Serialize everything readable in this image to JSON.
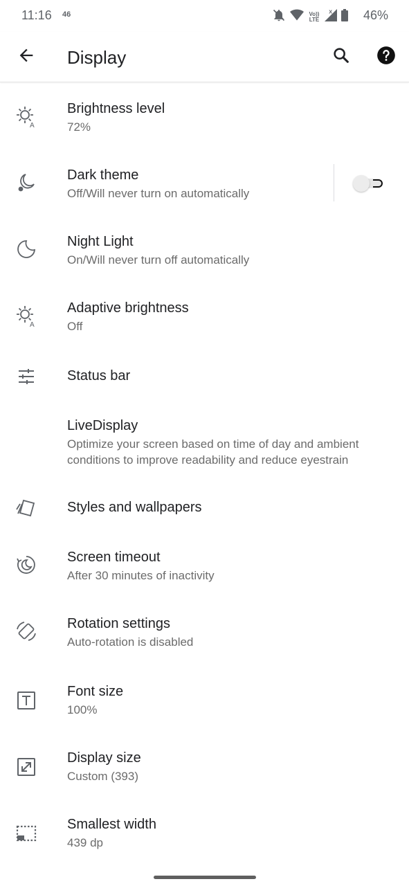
{
  "status_bar": {
    "time": "11:16",
    "network": "46",
    "volte_line1": "Vo))",
    "volte_line2": "LTE",
    "battery": "46%"
  },
  "app_bar": {
    "title": "Display",
    "icons": [
      "back-arrow-icon",
      "search-icon",
      "help-icon"
    ]
  },
  "settings": [
    {
      "title": "Brightness level",
      "summary": "72%",
      "icon": "brightness-auto-icon"
    },
    {
      "title": "Dark theme",
      "summary": "Off/Will never turn on automatically",
      "icon": "dark-theme-icon",
      "toggle": "off"
    },
    {
      "title": "Night Light",
      "summary": "On/Will never turn off automatically",
      "icon": "night-light-icon"
    },
    {
      "title": "Adaptive brightness",
      "summary": "Off",
      "icon": "adaptive-brightness-icon"
    },
    {
      "title": "Status bar",
      "summary": "",
      "icon": "tune-icon"
    },
    {
      "title": "LiveDisplay",
      "summary": "Optimize your screen based on time of day and ambient conditions to improve readability and reduce eyestrain",
      "icon": ""
    },
    {
      "title": "Styles and wallpapers",
      "summary": "",
      "icon": "styles-icon"
    },
    {
      "title": "Screen timeout",
      "summary": "After 30 minutes of inactivity",
      "icon": "screen-timeout-icon"
    },
    {
      "title": "Rotation settings",
      "summary": "Auto-rotation is disabled",
      "icon": "rotation-icon"
    },
    {
      "title": "Font size",
      "summary": "100%",
      "icon": "font-size-icon"
    },
    {
      "title": "Display size",
      "summary": "Custom (393)",
      "icon": "display-size-icon"
    },
    {
      "title": "Smallest width",
      "summary": "439 dp",
      "icon": "smallest-width-icon"
    }
  ]
}
